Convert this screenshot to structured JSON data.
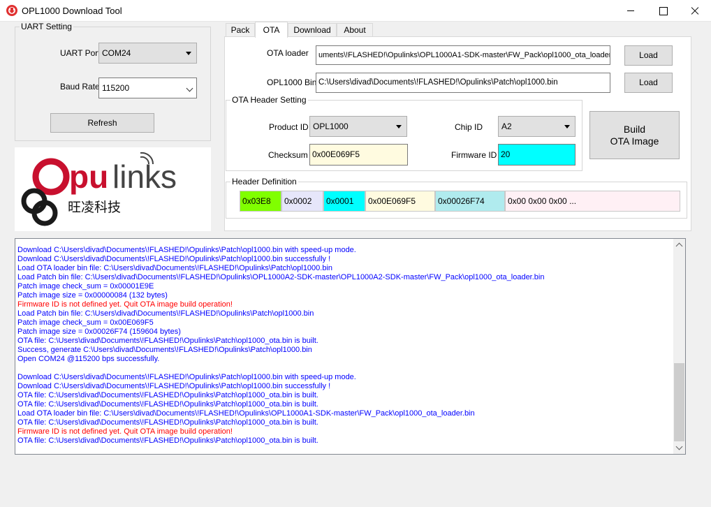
{
  "window": {
    "title": "OPL1000 Download Tool"
  },
  "uart": {
    "group_title": "UART Setting",
    "port_label": "UART Port",
    "port_value": "COM24",
    "baud_label": "Baud Rate",
    "baud_value": "115200",
    "refresh_label": "Refresh"
  },
  "logo": {
    "brand_text": "Opulinks",
    "chinese_text": "旺凌科技"
  },
  "tabs": [
    {
      "label": "Pack"
    },
    {
      "label": "OTA"
    },
    {
      "label": "Download"
    },
    {
      "label": "About"
    }
  ],
  "ota": {
    "loader_label": "OTA loader",
    "loader_path": "uments\\!FLASHED!\\Opulinks\\OPL1000A1-SDK-master\\FW_Pack\\opl1000_ota_loader.bin",
    "bin_label": "OPL1000 Bin",
    "bin_path": "C:\\Users\\divad\\Documents\\!FLASHED!\\Opulinks\\Patch\\opl1000.bin",
    "load_label": "Load",
    "header_group_title": "OTA Header Setting",
    "product_id_label": "Product ID",
    "product_id_value": "OPL1000",
    "chip_id_label": "Chip ID",
    "chip_id_value": "A2",
    "checksum_label": "Checksum",
    "checksum_value": "0x00E069F5",
    "firmware_id_label": "Firmware ID",
    "firmware_id_value": "20",
    "build_label_line1": "Build",
    "build_label_line2": "OTA Image",
    "header_def_title": "Header Definition",
    "header_cells": [
      {
        "text": "0x03E8",
        "color": "#80ff00"
      },
      {
        "text": "0x0002",
        "color": "#e6e6fa"
      },
      {
        "text": "0x0001",
        "color": "#00ffff"
      },
      {
        "text": "0x00E069F5",
        "color": "#fffbe0"
      },
      {
        "text": "0x00026F74",
        "color": "#b0ebee"
      },
      {
        "text": "0x00 0x00 0x00 ...",
        "color": "#fff0f5"
      }
    ]
  },
  "log": {
    "lines": [
      {
        "text": "Download C:\\Users\\divad\\Documents\\!FLASHED!\\Opulinks\\Patch\\opl1000.bin with speed-up mode.",
        "color": "#0000ff"
      },
      {
        "text": "Download C:\\Users\\divad\\Documents\\!FLASHED!\\Opulinks\\Patch\\opl1000.bin successfully !",
        "color": "#0000ff"
      },
      {
        "text": "Load OTA loader bin file: C:\\Users\\divad\\Documents\\!FLASHED!\\Opulinks\\Patch\\opl1000.bin",
        "color": "#0000ff"
      },
      {
        "text": "Load Patch bin file: C:\\Users\\divad\\Documents\\!FLASHED!\\Opulinks\\OPL1000A2-SDK-master\\OPL1000A2-SDK-master\\FW_Pack\\opl1000_ota_loader.bin",
        "color": "#0000ff"
      },
      {
        "text": "Patch image check_sum = 0x00001E9E",
        "color": "#0000ff"
      },
      {
        "text": "Patch image size = 0x00000084 (132 bytes)",
        "color": "#0000ff"
      },
      {
        "text": "Firmware ID is not defined yet. Quit OTA image build operation!",
        "color": "#ff0000"
      },
      {
        "text": "Load Patch bin file: C:\\Users\\divad\\Documents\\!FLASHED!\\Opulinks\\Patch\\opl1000.bin",
        "color": "#0000ff"
      },
      {
        "text": "Patch image check_sum = 0x00E069F5",
        "color": "#0000ff"
      },
      {
        "text": "Patch image size = 0x00026F74 (159604 bytes)",
        "color": "#0000ff"
      },
      {
        "text": "OTA file: C:\\Users\\divad\\Documents\\!FLASHED!\\Opulinks\\Patch\\opl1000_ota.bin is built.",
        "color": "#0000ff"
      },
      {
        "text": "Success, generate C:\\Users\\divad\\Documents\\!FLASHED!\\Opulinks\\Patch\\opl1000.bin",
        "color": "#0000ff"
      },
      {
        "text": "Open COM24 @115200 bps successfully.",
        "color": "#0000ff"
      },
      {
        "text": "",
        "color": "#0000ff"
      },
      {
        "text": "Download C:\\Users\\divad\\Documents\\!FLASHED!\\Opulinks\\Patch\\opl1000.bin with speed-up mode.",
        "color": "#0000ff"
      },
      {
        "text": "Download C:\\Users\\divad\\Documents\\!FLASHED!\\Opulinks\\Patch\\opl1000.bin successfully !",
        "color": "#0000ff"
      },
      {
        "text": "OTA file: C:\\Users\\divad\\Documents\\!FLASHED!\\Opulinks\\Patch\\opl1000_ota.bin is built.",
        "color": "#0000ff"
      },
      {
        "text": "OTA file: C:\\Users\\divad\\Documents\\!FLASHED!\\Opulinks\\Patch\\opl1000_ota.bin is built.",
        "color": "#0000ff"
      },
      {
        "text": "Load OTA loader bin file: C:\\Users\\divad\\Documents\\!FLASHED!\\Opulinks\\OPL1000A1-SDK-master\\FW_Pack\\opl1000_ota_loader.bin",
        "color": "#0000ff"
      },
      {
        "text": "OTA file: C:\\Users\\divad\\Documents\\!FLASHED!\\Opulinks\\Patch\\opl1000_ota.bin is built.",
        "color": "#0000ff"
      },
      {
        "text": "Firmware ID is not defined yet. Quit OTA image build operation!",
        "color": "#ff0000"
      },
      {
        "text": "OTA file: C:\\Users\\divad\\Documents\\!FLASHED!\\Opulinks\\Patch\\opl1000_ota.bin is built.",
        "color": "#0000ff"
      }
    ]
  }
}
